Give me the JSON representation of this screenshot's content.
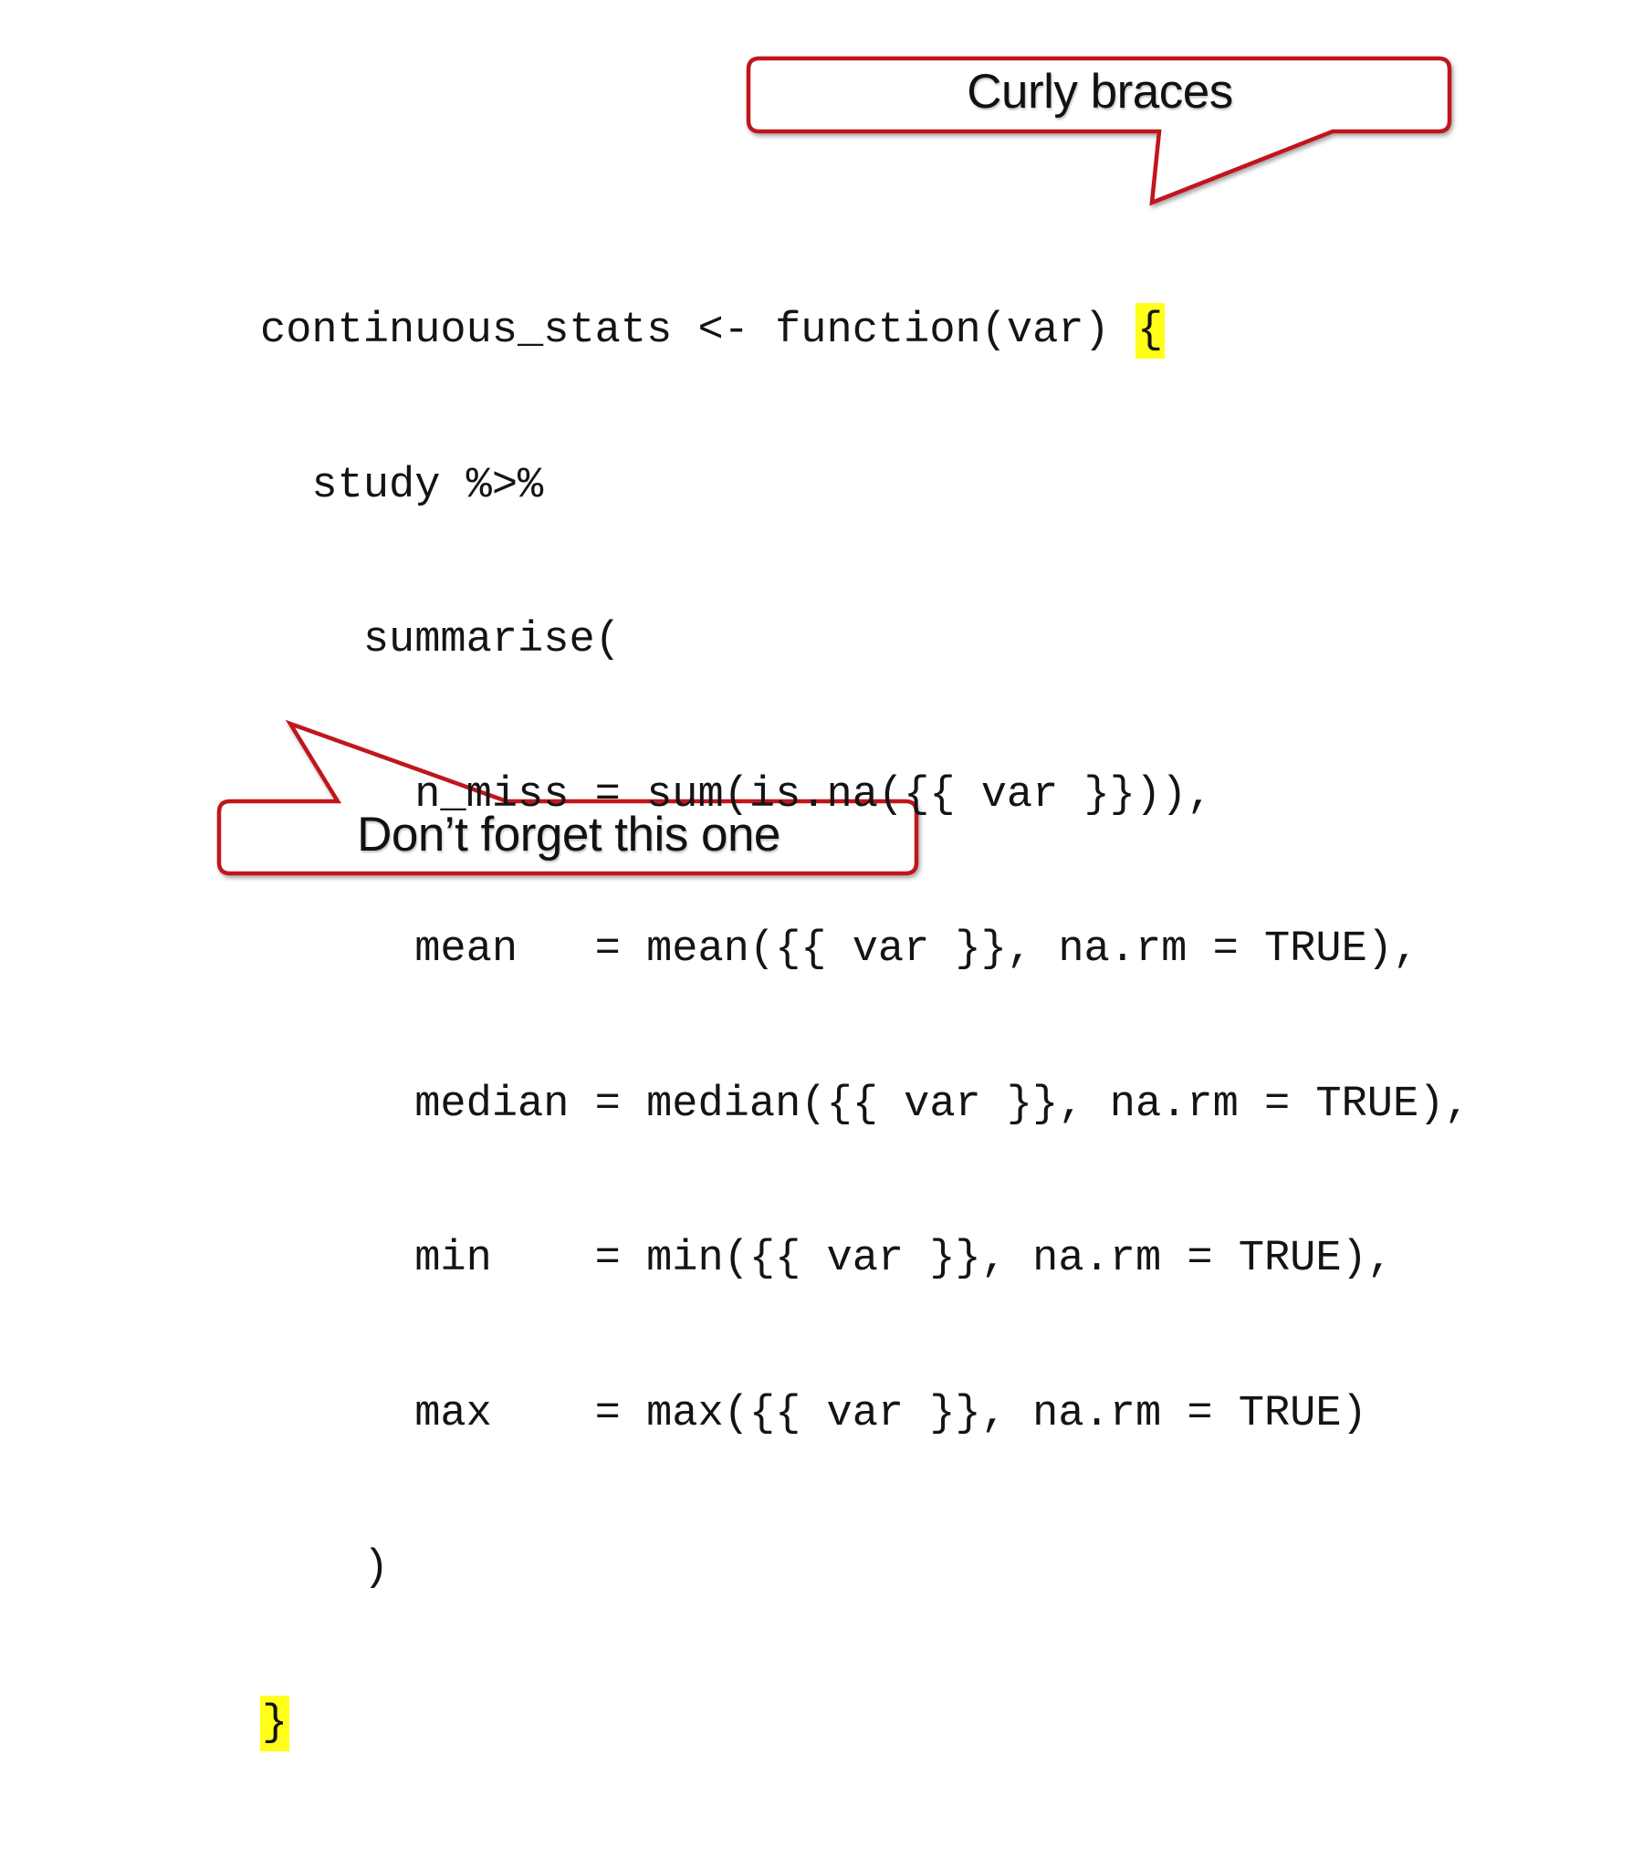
{
  "callouts": {
    "top": {
      "label": "Curly braces"
    },
    "bottom": {
      "label": "Don’t forget this one"
    }
  },
  "code": {
    "line1_prefix": "continuous_stats <- function(var) ",
    "open_brace": "{",
    "line2": "  study %>%",
    "line3": "    summarise(",
    "line4": "      n_miss = sum(is.na({{ var }})),",
    "line5": "      mean   = mean({{ var }}, na.rm = TRUE),",
    "line6": "      median = median({{ var }}, na.rm = TRUE),",
    "line7": "      min    = min({{ var }}, na.rm = TRUE),",
    "line8": "      max    = max({{ var }}, na.rm = TRUE)",
    "line9": "    )",
    "close_brace": "}"
  },
  "colors": {
    "callout_border": "#c0121b",
    "highlight": "#ffff1a"
  }
}
